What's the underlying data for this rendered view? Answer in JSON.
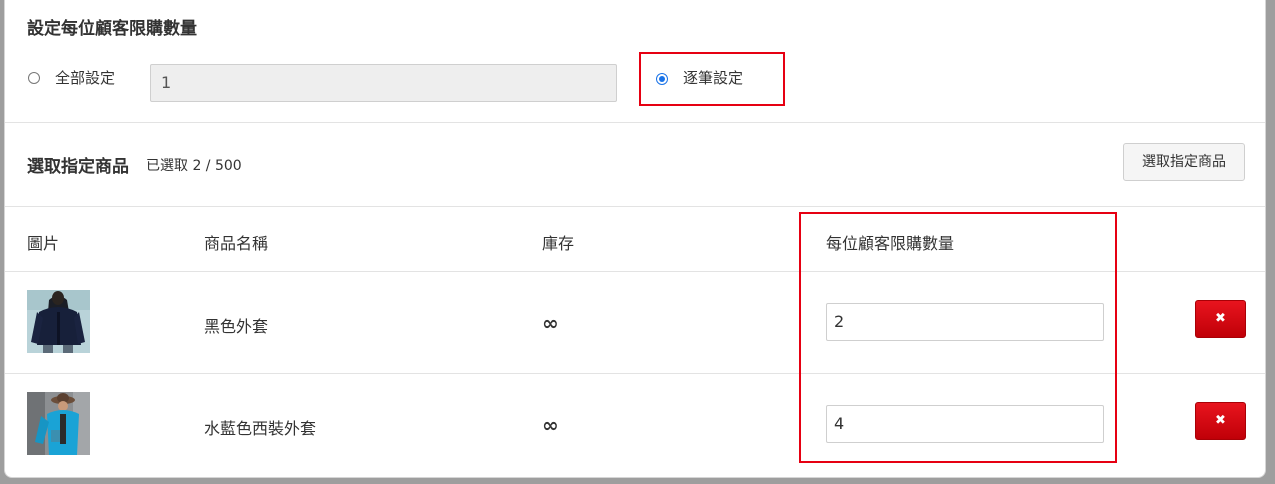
{
  "limit_section": {
    "title": "設定每位顧客限購數量",
    "option_all_label": "全部設定",
    "option_all_value": "1",
    "option_each_label": "逐筆設定",
    "selected_option": "逐筆設定"
  },
  "product_section": {
    "title": "選取指定商品",
    "count_text": "已選取 2 / 500",
    "select_button": "選取指定商品"
  },
  "table": {
    "headers": {
      "image": "圖片",
      "name": "商品名稱",
      "stock": "庫存",
      "limit": "每位顧客限購數量"
    },
    "rows": [
      {
        "name": "黑色外套",
        "stock": "∞",
        "limit": "2",
        "delete_icon": "✖"
      },
      {
        "name": "水藍色西裝外套",
        "stock": "∞",
        "limit": "4",
        "delete_icon": "✖"
      }
    ]
  },
  "colors": {
    "highlight_red": "#e60012",
    "radio_blue": "#1a73e8",
    "delete_red": "#d40d14"
  },
  "icons": [
    "radio-unchecked-icon",
    "radio-checked-icon",
    "close-icon"
  ]
}
